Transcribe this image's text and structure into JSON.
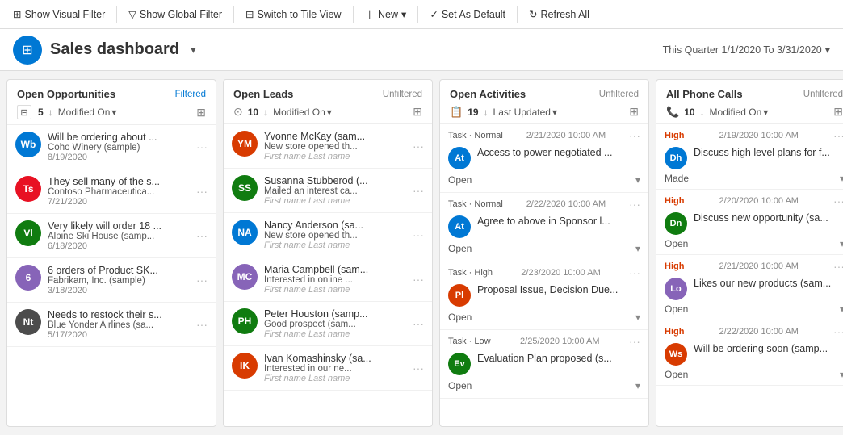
{
  "toolbar": {
    "show_visual_filter": "Show Visual Filter",
    "show_global_filter": "Show Global Filter",
    "switch_tile_view": "Switch to Tile View",
    "new_label": "New",
    "set_default": "Set As Default",
    "refresh_all": "Refresh All"
  },
  "header": {
    "title": "Sales dashboard",
    "quarter_label": "This Quarter 1/1/2020 To 3/31/2020"
  },
  "columns": {
    "open_opportunities": {
      "title": "Open Opportunities",
      "filter_status": "Filtered",
      "count": 5,
      "sort_label": "Modified On",
      "cards": [
        {
          "initials": "Wb",
          "bg": "#0078d4",
          "title": "Will be ordering about ...",
          "subtitle": "Coho Winery (sample)",
          "date": "8/19/2020"
        },
        {
          "initials": "Ts",
          "bg": "#e81123",
          "title": "They sell many of the s...",
          "subtitle": "Contoso Pharmaceutica...",
          "date": "7/21/2020"
        },
        {
          "initials": "Vl",
          "bg": "#107c10",
          "title": "Very likely will order 18 ...",
          "subtitle": "Alpine Ski House (samp...",
          "date": "6/18/2020"
        },
        {
          "initials": "6",
          "bg": "#8764b8",
          "title": "6 orders of Product SK...",
          "subtitle": "Fabrikam, Inc. (sample)",
          "date": "3/18/2020"
        },
        {
          "initials": "Nt",
          "bg": "#4c4c4c",
          "title": "Needs to restock their s...",
          "subtitle": "Blue Yonder Airlines (sa...",
          "date": "5/17/2020"
        }
      ]
    },
    "open_leads": {
      "title": "Open Leads",
      "filter_status": "Unfiltered",
      "count": 10,
      "sort_label": "Modified On",
      "cards": [
        {
          "initials": "YM",
          "bg": "#d83b01",
          "title": "Yvonne McKay (sam...",
          "subtitle": "New store opened th...",
          "meta": "First name  Last name"
        },
        {
          "initials": "SS",
          "bg": "#107c10",
          "title": "Susanna Stubberod (...",
          "subtitle": "Mailed an interest ca...",
          "meta": "First name  Last name"
        },
        {
          "initials": "NA",
          "bg": "#0078d4",
          "title": "Nancy Anderson (sa...",
          "subtitle": "New store opened th...",
          "meta": "First name  Last name"
        },
        {
          "initials": "MC",
          "bg": "#8764b8",
          "title": "Maria Campbell (sam...",
          "subtitle": "Interested in online ...",
          "meta": "First name  Last name"
        },
        {
          "initials": "PH",
          "bg": "#107c10",
          "title": "Peter Houston (samp...",
          "subtitle": "Good prospect (sam...",
          "meta": "First name  Last name"
        },
        {
          "initials": "IK",
          "bg": "#d83b01",
          "title": "Ivan Komashinsky (sa...",
          "subtitle": "Interested in our ne...",
          "meta": "First name  Last name"
        }
      ]
    },
    "open_activities": {
      "title": "Open Activities",
      "filter_status": "Unfiltered",
      "count": 19,
      "sort_label": "Last Updated",
      "items": [
        {
          "type": "Task",
          "priority": "Normal",
          "date": "2/21/2020 10:00 AM",
          "avatar_initials": "At",
          "avatar_bg": "#0078d4",
          "title": "Access to power negotiated ...",
          "status": "Open",
          "status_expandable": true
        },
        {
          "type": "Task",
          "priority": "Normal",
          "date": "2/22/2020 10:00 AM",
          "avatar_initials": "At",
          "avatar_bg": "#0078d4",
          "title": "Agree to above in Sponsor l...",
          "status": "Open",
          "status_expandable": true
        },
        {
          "type": "Task",
          "priority": "High",
          "date": "2/23/2020 10:00 AM",
          "avatar_initials": "Pl",
          "avatar_bg": "#d83b01",
          "title": "Proposal Issue, Decision Due...",
          "status": "Open",
          "status_expandable": true
        },
        {
          "type": "Task",
          "priority": "Low",
          "date": "2/25/2020 10:00 AM",
          "avatar_initials": "Ev",
          "avatar_bg": "#107c10",
          "title": "Evaluation Plan proposed (s...",
          "status": "Open",
          "status_expandable": true
        }
      ]
    },
    "all_phone_calls": {
      "title": "All Phone Calls",
      "filter_status": "Unfiltered",
      "count": 10,
      "sort_label": "Modified On",
      "items": [
        {
          "priority": "High",
          "date": "2/19/2020 10:00 AM",
          "avatar_initials": "Dh",
          "avatar_bg": "#0078d4",
          "title": "Discuss high level plans for f...",
          "status": "Made",
          "status_expandable": true
        },
        {
          "priority": "High",
          "date": "2/20/2020 10:00 AM",
          "avatar_initials": "Dn",
          "avatar_bg": "#107c10",
          "title": "Discuss new opportunity (sa...",
          "status": "Open",
          "status_expandable": true
        },
        {
          "priority": "High",
          "date": "2/21/2020 10:00 AM",
          "avatar_initials": "Lo",
          "avatar_bg": "#8764b8",
          "title": "Likes our new products (sam...",
          "status": "Open",
          "status_expandable": true
        },
        {
          "priority": "High",
          "date": "2/22/2020 10:00 AM",
          "avatar_initials": "Ws",
          "avatar_bg": "#d83b01",
          "title": "Will be ordering soon (samp...",
          "status": "Open",
          "status_expandable": true
        }
      ]
    }
  }
}
